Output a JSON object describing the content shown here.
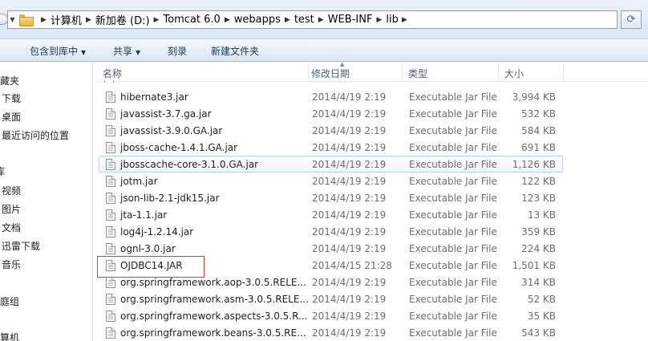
{
  "breadcrumb": [
    "计算机",
    "新加卷 (D:)",
    "Tomcat 6.0",
    "webapps",
    "test",
    "WEB-INF",
    "lib"
  ],
  "toolbar": {
    "include_library": "包含到库中",
    "share": "共享",
    "burn": "刻录",
    "new_folder": "新建文件夹"
  },
  "nav": {
    "favorites": "收藏夹",
    "downloads": "下载",
    "desktop": "桌面",
    "recent": "最近访问的位置",
    "libraries": "库",
    "videos": "视频",
    "pictures": "图片",
    "documents": "文档",
    "thunder": "迅雷下载",
    "music": "音乐",
    "homegroup": "家庭组",
    "computer": "计算机"
  },
  "columns": {
    "name": "名称",
    "modified": "修改日期",
    "type": "类型",
    "size": "大小"
  },
  "files": [
    {
      "name": "hibernate3.jar",
      "date": "2014/4/19 2:19",
      "type": "Executable Jar File",
      "size": "3,994 KB"
    },
    {
      "name": "javassist-3.7.ga.jar",
      "date": "2014/4/19 2:19",
      "type": "Executable Jar File",
      "size": "532 KB"
    },
    {
      "name": "javassist-3.9.0.GA.jar",
      "date": "2014/4/19 2:19",
      "type": "Executable Jar File",
      "size": "584 KB"
    },
    {
      "name": "jboss-cache-1.4.1.GA.jar",
      "date": "2014/4/19 2:19",
      "type": "Executable Jar File",
      "size": "691 KB"
    },
    {
      "name": "jbosscache-core-3.1.0.GA.jar",
      "date": "2014/4/19 2:19",
      "type": "Executable Jar File",
      "size": "1,126 KB"
    },
    {
      "name": "jotm.jar",
      "date": "2014/4/19 2:19",
      "type": "Executable Jar File",
      "size": "122 KB"
    },
    {
      "name": "json-lib-2.1-jdk15.jar",
      "date": "2014/4/19 2:19",
      "type": "Executable Jar File",
      "size": "123 KB"
    },
    {
      "name": "jta-1.1.jar",
      "date": "2014/4/19 2:19",
      "type": "Executable Jar File",
      "size": "13 KB"
    },
    {
      "name": "log4j-1.2.14.jar",
      "date": "2014/4/19 2:19",
      "type": "Executable Jar File",
      "size": "359 KB"
    },
    {
      "name": "ognl-3.0.jar",
      "date": "2014/4/19 2:19",
      "type": "Executable Jar File",
      "size": "224 KB"
    },
    {
      "name": "OJDBC14.JAR",
      "date": "2014/4/15 21:28",
      "type": "Executable Jar File",
      "size": "1,501 KB"
    },
    {
      "name": "org.springframework.aop-3.0.5.RELE...",
      "date": "2014/4/19 2:19",
      "type": "Executable Jar File",
      "size": "314 KB"
    },
    {
      "name": "org.springframework.asm-3.0.5.RELE...",
      "date": "2014/4/19 2:19",
      "type": "Executable Jar File",
      "size": "52 KB"
    },
    {
      "name": "org.springframework.aspects-3.0.5.R...",
      "date": "2014/4/19 2:19",
      "type": "Executable Jar File",
      "size": "35 KB"
    },
    {
      "name": "org.springframework.beans-3.0.5.RE...",
      "date": "2014/4/19 2:19",
      "type": "Executable Jar File",
      "size": "543 KB"
    }
  ],
  "icons": {
    "refresh": "refresh-icon",
    "folder": "folder-icon",
    "file": "jar-file-icon"
  }
}
